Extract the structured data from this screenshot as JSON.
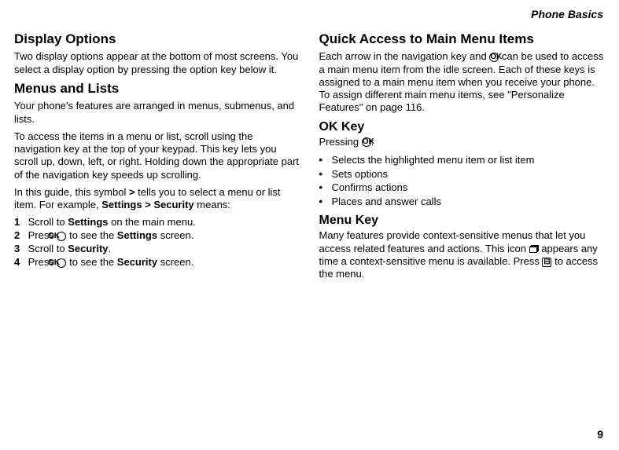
{
  "header": {
    "chapter": "Phone Basics"
  },
  "page_number": "9",
  "left": {
    "h_display": "Display Options",
    "p_display": "Two display options appear at the bottom of most screens. You select a display option by pressing the option key below it.",
    "h_menus": "Menus and Lists",
    "p_menus1": "Your phone's features are arranged in menus, submenus, and lists.",
    "p_menus2": "To access the items in a menu or list, scroll using the navigation key at the top of your keypad. This key lets you scroll up, down, left, or right. Holding down the appropriate part of the navigation key speeds up scrolling.",
    "p_menus3_a": "In this guide, this symbol ",
    "p_menus3_gt": ">",
    "p_menus3_b": " tells you to select a menu or list item. For example, ",
    "p_menus3_ex": "Settings > Security",
    "p_menus3_c": " means:",
    "steps": {
      "s1a": "Scroll to ",
      "s1b": "Settings",
      "s1c": " on the main menu.",
      "s2a": "Press ",
      "s2b": " to see the ",
      "s2c": "Settings",
      "s2d": " screen.",
      "s3a": "Scroll to ",
      "s3b": "Security",
      "s3c": ".",
      "s4a": "Press ",
      "s4b": " to see the ",
      "s4c": "Security",
      "s4d": " screen."
    }
  },
  "right": {
    "h_quick": "Quick Access to Main Menu Items",
    "p_quick_a": "Each arrow in the navigation key and ",
    "p_quick_b": " can be used to access a main menu item from the idle screen. Each of these keys is assigned to a main menu item when you receive your phone. To assign different main menu items, see \"Personalize Features\" on page 116.",
    "h_ok": "OK Key",
    "p_ok_a": "Pressing ",
    "p_ok_b": ":",
    "bullets": {
      "b1": "Selects the highlighted menu item or list item",
      "b2": "Sets options",
      "b3": "Confirms actions",
      "b4": "Places and answer calls"
    },
    "h_menu": "Menu Key",
    "p_menu_a": "Many features provide context-sensitive menus that let you access related features and actions. This icon ",
    "p_menu_b": " appears any time a context-sensitive menu is available. Press ",
    "p_menu_c": " to access the menu."
  }
}
